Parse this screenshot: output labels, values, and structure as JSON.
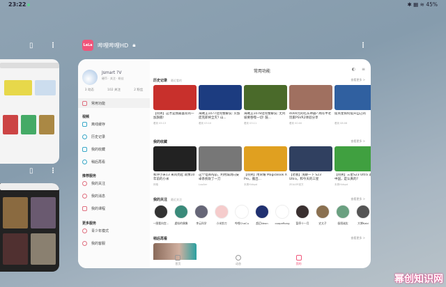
{
  "status": {
    "time": "23:22",
    "battery": "45%"
  },
  "app": {
    "name": "哔哩哔哩HD",
    "logo": "bilibili-logo"
  },
  "profile": {
    "name": "Jsmart ?V",
    "sub": "硬币 · 关注 · 粉丝",
    "stats": [
      "3 动态",
      "102 关注",
      "2 粉丝"
    ]
  },
  "sidebar": {
    "active": "常用功能",
    "groups": [
      {
        "title": "视频",
        "items": [
          "离线缓存",
          "历史记录",
          "我的收藏",
          "稍后再看"
        ]
      },
      {
        "title": "推荐服务",
        "items": [
          "我的关注",
          "我的消息",
          "我的课程"
        ]
      },
      {
        "title": "更多服务",
        "items": [
          "青少年模式",
          "我的客服"
        ]
      }
    ]
  },
  "main": {
    "title": "常用功能",
    "more": "查看更多 >",
    "history": {
      "title": "历史记录",
      "sub": "最近看的",
      "videos": [
        {
          "title": "【热男】这才是我最喜欢的一加旗舰!",
          "meta": "看到 05:13",
          "color": "#c8302c"
        },
        {
          "title": "海贼王1077话完整解说: 贝加庞克即将全灭? 山...",
          "meta": "看到 03:10",
          "color": "#1c3c80"
        },
        {
          "title": "海贼王1078话完整解说: 无列坡要吞噬一切! 鼓...",
          "meta": "看到 03:11",
          "color": "#4a6a2a"
        },
        {
          "title": "4000元的吃灰神器? 两年半老玩家PSVR2体验分享",
          "meta": "看到 00:00",
          "color": "#a07060"
        },
        {
          "title": "提英星如何提升自己的",
          "meta": "看到 08:06",
          "color": "#3060a0"
        }
      ]
    },
    "favorites": {
      "title": "我的收藏",
      "videos": [
        {
          "title": "和评小米13 来风亮起 就像10年前的小米",
          "meta": "林格",
          "color": "#222"
        },
        {
          "title": "这个电商App，利用漏洞向安卓系统砍了一刀",
          "meta": "LuoAer",
          "color": "#777"
        },
        {
          "title": "【热男】用荣耀 MagicBook X Pro，搬出...",
          "meta": "本周Hidspd",
          "color": "#e0a020"
        },
        {
          "title": "【老板】浅聊一下 S23 Ultra，和今天的三星",
          "meta": "ZEALER官方",
          "color": "#304060"
        },
        {
          "title": "【热男】三星S23 Ultra 退出中国，是认真的?",
          "meta": "本周Hidspd",
          "color": "#40a040"
        }
      ]
    },
    "following": {
      "title": "我的关注",
      "sub": "最近关注",
      "users": [
        {
          "name": "一图看向宫...",
          "color": "#333"
        },
        {
          "name": "虚拟的偶像",
          "color": "#3a8a7a"
        },
        {
          "name": "李云科学",
          "color": "#667"
        },
        {
          "name": "小米剪刀",
          "color": "#f5cccc"
        },
        {
          "name": "哔哩ChaCu",
          "color": "#fff"
        },
        {
          "name": "超迈Neon",
          "color": "#203070"
        },
        {
          "name": "coopeRong",
          "color": "#fff"
        },
        {
          "name": "暂停十一月",
          "color": "#3a3030"
        },
        {
          "name": "史太子",
          "color": "#8a7050"
        },
        {
          "name": "极限诚实",
          "color": "#6aa080"
        },
        {
          "name": "大博Kabi",
          "color": "#555"
        }
      ]
    },
    "later": {
      "title": "稍后再看"
    }
  },
  "nav": [
    "首页",
    "动态",
    "我的"
  ],
  "watermark": "幂创知识网"
}
